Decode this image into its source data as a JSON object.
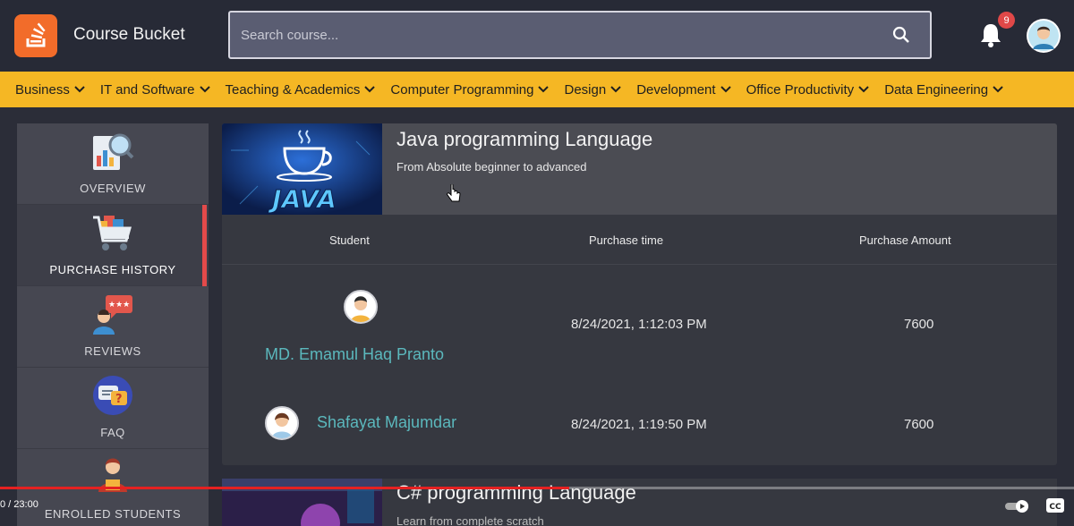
{
  "header": {
    "brand": "Course Bucket",
    "search_placeholder": "Search course...",
    "notification_count": "9"
  },
  "categories": [
    {
      "label": "Business"
    },
    {
      "label": "IT and Software"
    },
    {
      "label": "Teaching & Academics"
    },
    {
      "label": "Computer Programming"
    },
    {
      "label": "Design"
    },
    {
      "label": "Development"
    },
    {
      "label": "Office Productivity"
    },
    {
      "label": "Data Engineering"
    }
  ],
  "sidebar": {
    "items": [
      {
        "label": "OVERVIEW",
        "icon": "overview-chart-icon"
      },
      {
        "label": "PURCHASE HISTORY",
        "icon": "shopping-cart-icon",
        "active": true
      },
      {
        "label": "REVIEWS",
        "icon": "reviews-icon"
      },
      {
        "label": "FAQ",
        "icon": "faq-icon"
      },
      {
        "label": "ENROLLED STUDENTS",
        "icon": "enrolled-students-icon"
      }
    ]
  },
  "course": {
    "title": "Java programming Language",
    "subtitle": "From Absolute beginner to advanced",
    "thumbnail_text": "JAVA",
    "table": {
      "headers": [
        "Student",
        "Purchase time",
        "Purchase Amount"
      ],
      "rows": [
        {
          "student": "MD. Emamul Haq Pranto",
          "time": "8/24/2021, 1:12:03 PM",
          "amount": "7600"
        },
        {
          "student": "Shafayat Majumdar",
          "time": "8/24/2021, 1:19:50 PM",
          "amount": "7600"
        }
      ]
    }
  },
  "course2": {
    "title": "C# programming Language",
    "subtitle": "Learn from complete scratch"
  },
  "video": {
    "time": "0 / 23:00",
    "progress_fraction": 0.53,
    "accent": "#e52121"
  },
  "colors": {
    "category_bar": "#f5b724",
    "student_name": "#5bb8bd",
    "active_indicator": "#e34a4a",
    "logo": "#f26c2a"
  }
}
